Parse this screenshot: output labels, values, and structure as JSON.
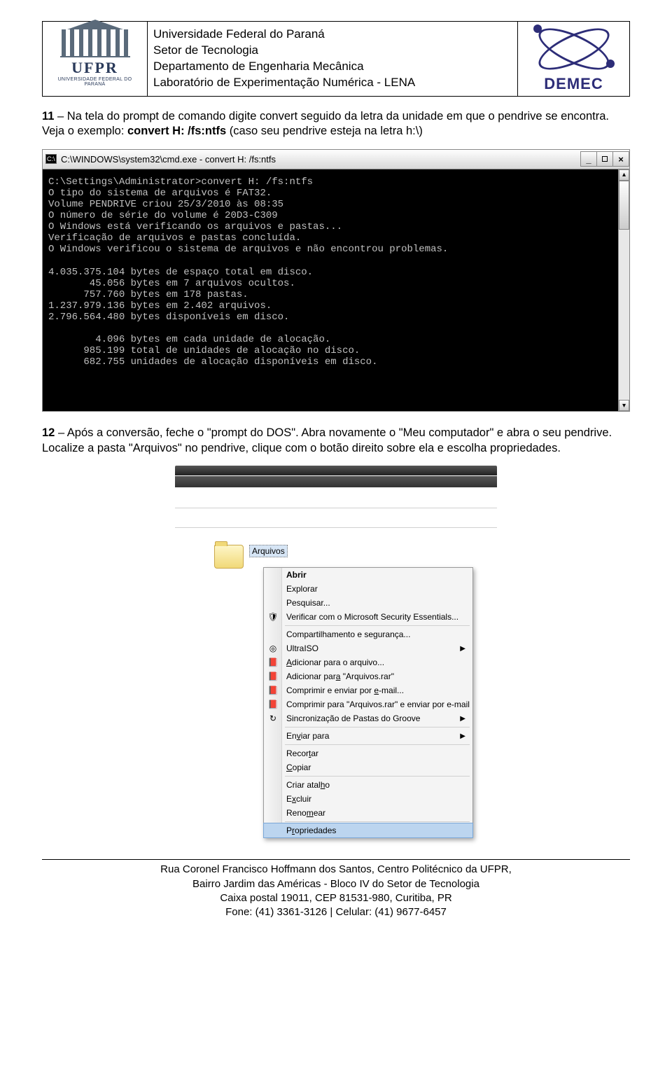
{
  "header": {
    "ufpr_label": "UFPR",
    "ufpr_sub": "UNIVERSIDADE FEDERAL DO PARANÁ",
    "lines": [
      "Universidade Federal do Paraná",
      "Setor de Tecnologia",
      "Departamento de Engenharia Mecânica",
      "Laboratório de Experimentação Numérica - LENA"
    ],
    "demec_label": "DEMEC"
  },
  "para11": {
    "num": "11",
    "text_a": " – Na tela do prompt de comando digite convert seguido da letra da unidade em que o pendrive se encontra. Veja o exemplo: ",
    "bold_cmd": "convert H: /fs:ntfs",
    "text_b": " (caso seu pendrive esteja na letra h:\\)"
  },
  "cmd": {
    "title": "C:\\WINDOWS\\system32\\cmd.exe - convert H: /fs:ntfs",
    "icon_text": "C:\\",
    "body": "C:\\Settings\\Administrator>convert H: /fs:ntfs\nO tipo do sistema de arquivos é FAT32.\nVolume PENDRIVE criou 25/3/2010 às 08:35\nO número de série do volume é 20D3-C309\nO Windows está verificando os arquivos e pastas...\nVerificação de arquivos e pastas concluída.\nO Windows verificou o sistema de arquivos e não encontrou problemas.\n\n4.035.375.104 bytes de espaço total em disco.\n       45.056 bytes em 7 arquivos ocultos.\n      757.760 bytes em 178 pastas.\n1.237.979.136 bytes em 2.402 arquivos.\n2.796.564.480 bytes disponíveis em disco.\n\n        4.096 bytes em cada unidade de alocação.\n      985.199 total de unidades de alocação no disco.\n      682.755 unidades de alocação disponíveis em disco."
  },
  "para12": {
    "num": "12",
    "text": " – Após a conversão, feche o \"prompt do DOS\". Abra novamente o \"Meu computador\" e abra o seu pendrive. Localize a pasta \"Arquivos\" no pendrive, clique com o botão direito sobre ela e escolha propriedades."
  },
  "context": {
    "folder_name": "Arquivos",
    "items": [
      {
        "label": "Abrir",
        "bold": true
      },
      {
        "label": "Explorar"
      },
      {
        "label": "Pesquisar..."
      },
      {
        "label": "Verificar com o Microsoft Security Essentials...",
        "icon": "🛡"
      },
      {
        "sep": true
      },
      {
        "label": "Compartilhamento e segurança..."
      },
      {
        "label": "UltraISO",
        "icon": "◎",
        "submenu": true
      },
      {
        "label_html": "<span class='u'>A</span>dicionar para o arquivo...",
        "icon": "📕"
      },
      {
        "label_html": "Adicionar par<span class='u'>a</span> \"Arquivos.rar\"",
        "icon": "📕"
      },
      {
        "label_html": "Comprimir e enviar por <span class='u'>e</span>-mail...",
        "icon": "📕"
      },
      {
        "label_html": "Comprimir para \"Arquivos.rar\" e enviar por e-mail",
        "icon": "📕"
      },
      {
        "label": "Sincronização de Pastas do Groove",
        "icon": "↻",
        "submenu": true
      },
      {
        "sep": true
      },
      {
        "label_html": "En<span class='u'>v</span>iar para",
        "submenu": true
      },
      {
        "sep": true
      },
      {
        "label_html": "Recor<span class='u'>t</span>ar"
      },
      {
        "label_html": "<span class='u'>C</span>opiar"
      },
      {
        "sep": true
      },
      {
        "label_html": "Criar atal<span class='u'>h</span>o"
      },
      {
        "label_html": "E<span class='u'>x</span>cluir"
      },
      {
        "label_html": "Reno<span class='u'>m</span>ear"
      },
      {
        "sep": true
      },
      {
        "label_html": "P<span class='u'>r</span>opriedades",
        "hover": true
      }
    ]
  },
  "footer": {
    "l1": "Rua Coronel Francisco Hoffmann dos Santos, Centro Politécnico da UFPR,",
    "l2": "Bairro Jardim das Américas - Bloco IV do Setor de Tecnologia",
    "l3": "Caixa postal 19011, CEP 81531-980, Curitiba, PR",
    "l4": "Fone: (41) 3361-3126 | Celular: (41) 9677-6457"
  }
}
